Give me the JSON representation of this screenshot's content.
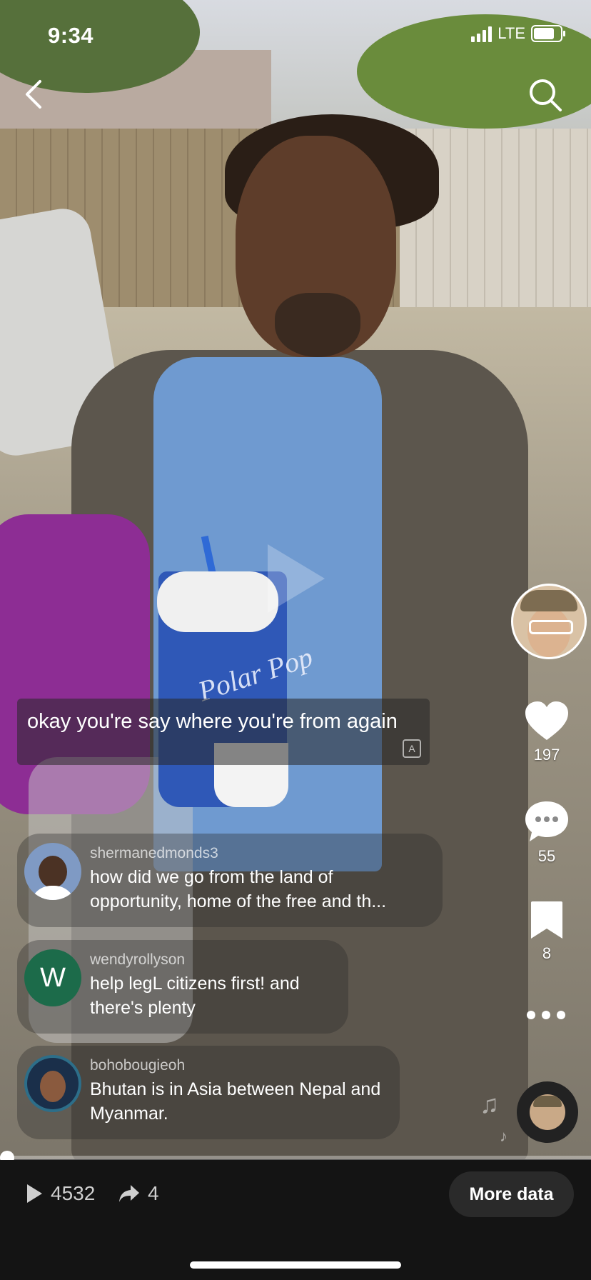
{
  "status_bar": {
    "time": "9:34",
    "network": "LTE"
  },
  "video": {
    "cup_logo": "Polar Pop"
  },
  "caption": {
    "text": "okay you're say where you're from again"
  },
  "actions": {
    "likes": "197",
    "comments": "55",
    "saves": "8"
  },
  "comments": [
    {
      "username": "shermanedmonds3",
      "text": "how did we go from the land of opportunity, home of the free and th..."
    },
    {
      "username": "wendyrollyson",
      "avatar_letter": "W",
      "text": "help legL citizens first! and there's plenty"
    },
    {
      "username": "bohobougieoh",
      "text": "Bhutan is in Asia between Nepal and Myanmar."
    }
  ],
  "progress": {
    "fraction": 0.0
  },
  "stats": {
    "plays": "4532",
    "shares": "4"
  },
  "bottom": {
    "more_data_label": "More data"
  }
}
